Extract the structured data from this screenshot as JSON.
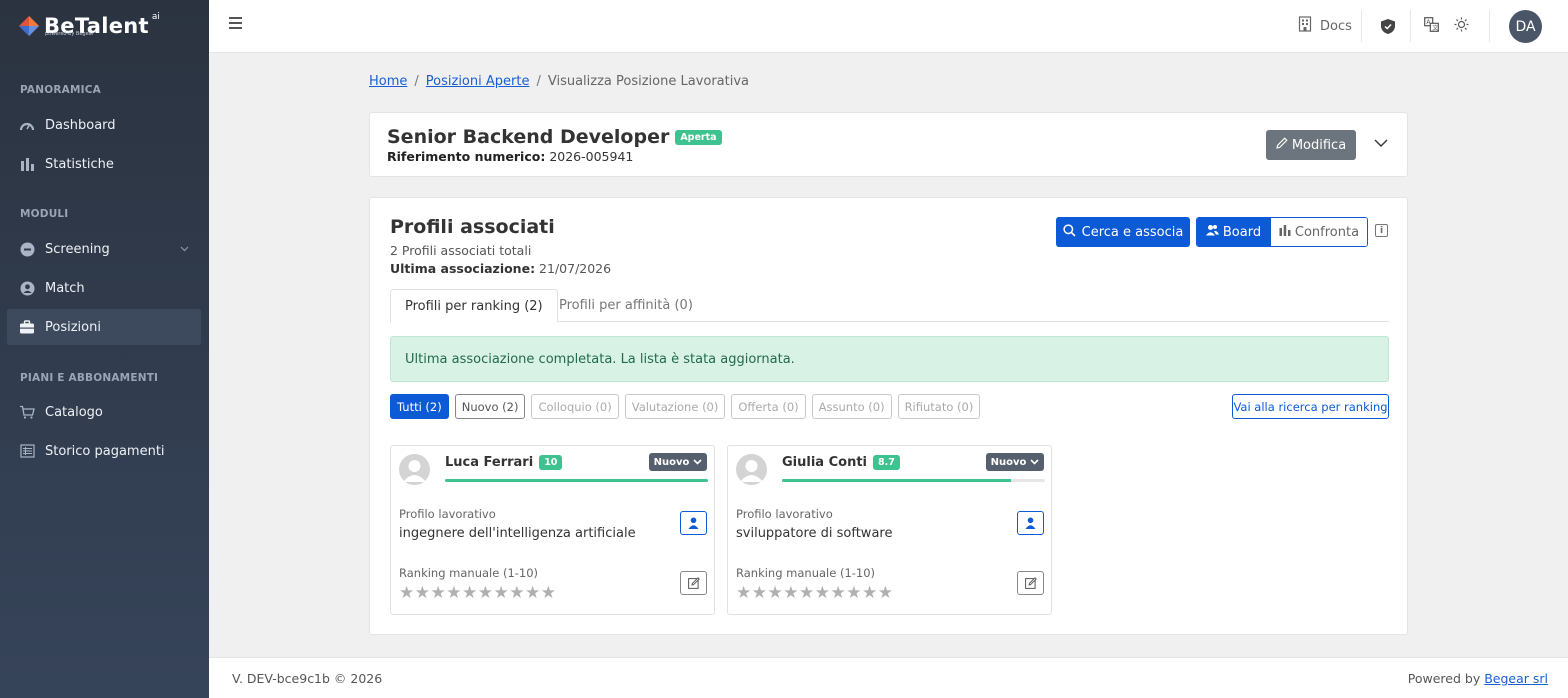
{
  "brand": {
    "name": "BeTalent",
    "suffix": "ai",
    "tagline": "powered by Begear"
  },
  "sidebar": {
    "sections": [
      {
        "title": "PANORAMICA"
      },
      {
        "title": "MODULI"
      },
      {
        "title": "PIANI E ABBONAMENTI"
      }
    ],
    "items": [
      {
        "label": "Dashboard",
        "icon": "gauge-icon"
      },
      {
        "label": "Statistiche",
        "icon": "bar-chart-icon"
      },
      {
        "label": "Screening",
        "icon": "screening-icon"
      },
      {
        "label": "Match",
        "icon": "user-circle-icon"
      },
      {
        "label": "Posizioni",
        "icon": "briefcase-icon"
      },
      {
        "label": "Catalogo",
        "icon": "cart-icon"
      },
      {
        "label": "Storico pagamenti",
        "icon": "receipt-icon"
      }
    ]
  },
  "topbar": {
    "docs_label": "Docs",
    "avatar_initials": "DA"
  },
  "breadcrumb": {
    "home": "Home",
    "open_positions": "Posizioni Aperte",
    "current": "Visualizza Posizione Lavorativa"
  },
  "position": {
    "title": "Senior Backend Developer",
    "status": "Aperta",
    "ref_label": "Riferimento numerico:",
    "ref_value": "2026-005941",
    "edit_label": "Modifica"
  },
  "profiles": {
    "title": "Profili associati",
    "total": "2 Profili associati totali",
    "last_label": "Ultima associazione:",
    "last_value": "21/07/2026",
    "search_label": "Cerca e associa",
    "board_label": "Board",
    "compare_label": "Confronta",
    "tabs": [
      {
        "label": "Profili per ranking (2)"
      },
      {
        "label": "Profili per affinità (0)"
      }
    ],
    "alert": "Ultima associazione completata. La lista è stata aggiornata.",
    "filters": [
      {
        "label": "Tutti (2)"
      },
      {
        "label": "Nuovo (2)"
      },
      {
        "label": "Colloquio (0)"
      },
      {
        "label": "Valutazione (0)"
      },
      {
        "label": "Offerta (0)"
      },
      {
        "label": "Assunto (0)"
      },
      {
        "label": "Rifiutato (0)"
      }
    ],
    "ranking_link": "Vai alla ricerca per ranking",
    "candidates": [
      {
        "name": "Luca Ferrari",
        "score": "10",
        "score_fraction": 1.0,
        "stage": "Nuovo",
        "profile_label": "Profilo lavorativo",
        "profile_value": "ingegnere dell'intelligenza artificiale",
        "ranking_label": "Ranking manuale (1-10)",
        "stars_filled": 0
      },
      {
        "name": "Giulia Conti",
        "score": "8.7",
        "score_fraction": 0.87,
        "stage": "Nuovo",
        "profile_label": "Profilo lavorativo",
        "profile_value": "sviluppatore di software",
        "ranking_label": "Ranking manuale (1-10)",
        "stars_filled": 0
      }
    ]
  },
  "footer": {
    "version": "V. DEV-bce9c1b © 2026",
    "powered": "Powered by",
    "company": "Begear srl"
  },
  "colors": {
    "primary": "#0d5ad6",
    "success": "#3ec28f",
    "sidebar": "#2b3340"
  }
}
